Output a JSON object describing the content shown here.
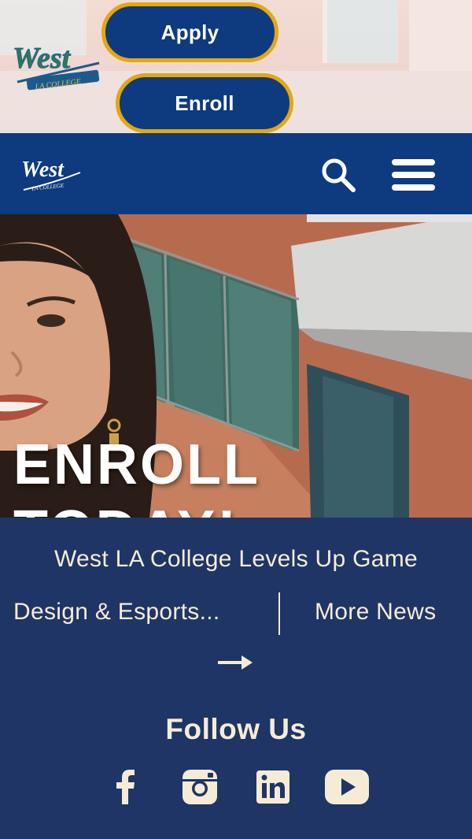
{
  "top_banner": {
    "apply_label": "Apply",
    "enroll_label": "Enroll",
    "logo_text": "West",
    "logo_subtext": "LA COLLEGE"
  },
  "navbar": {
    "logo_text": "West",
    "logo_subtext": "LA COLLEGE",
    "search_icon": "search-icon",
    "menu_icon": "hamburger-menu-icon"
  },
  "hero": {
    "title": "ENROLL TODAY!"
  },
  "news": {
    "headline_line1": "West LA College Levels Up Game",
    "headline_line2": "Design & Esports...",
    "more_news_label": "More News",
    "arrow_icon": "right-arrow-icon"
  },
  "follow": {
    "title": "Follow Us",
    "icons": [
      "facebook-icon",
      "instagram-icon",
      "linkedin-icon",
      "youtube-icon"
    ]
  },
  "colors": {
    "navy": "#0e3a7f",
    "footer_navy": "#1e3566",
    "gold": "#e3a80e",
    "cream": "#f6ecd6"
  }
}
